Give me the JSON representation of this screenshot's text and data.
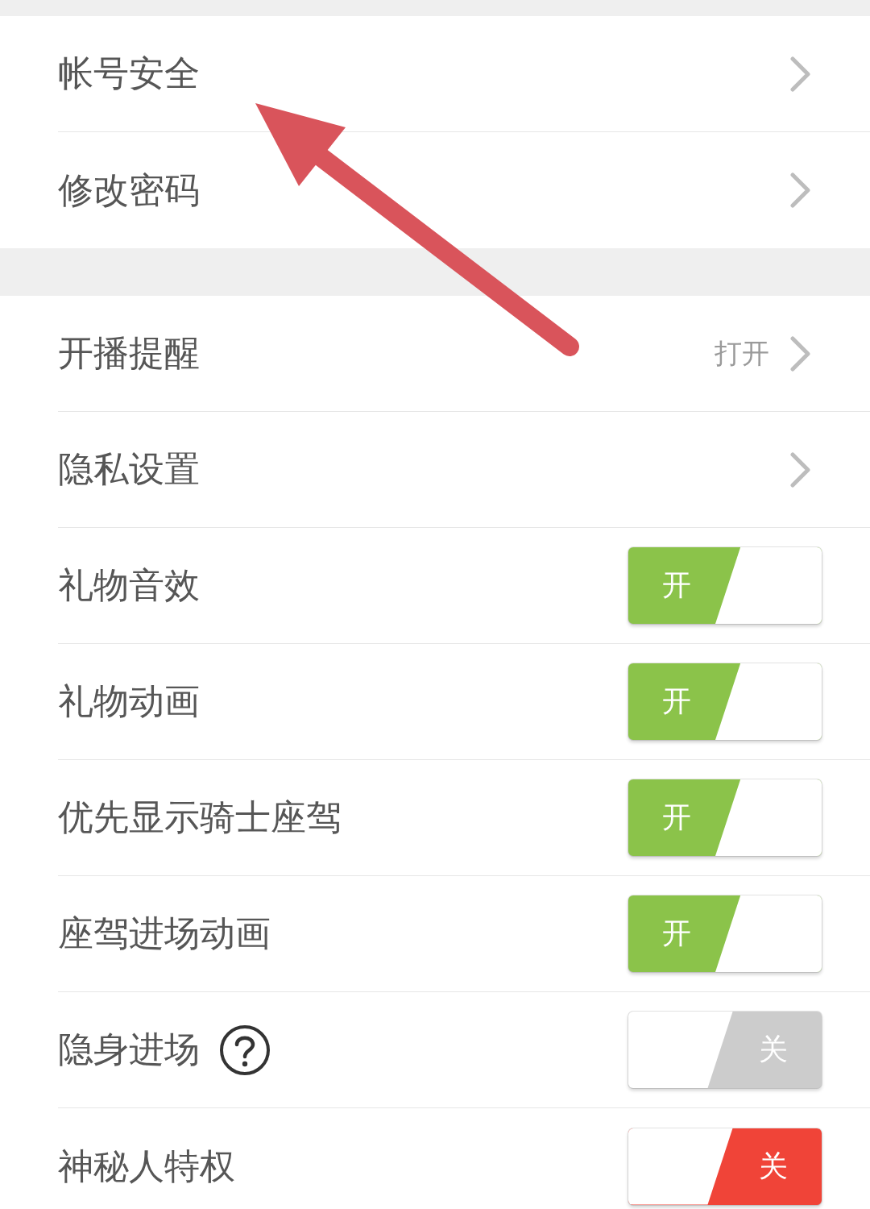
{
  "sections": [
    {
      "items": [
        {
          "kind": "link",
          "label": "帐号安全",
          "help": false
        },
        {
          "kind": "link",
          "label": "修改密码",
          "help": false
        }
      ]
    },
    {
      "items": [
        {
          "kind": "link",
          "label": "开播提醒",
          "value": "打开",
          "help": false
        },
        {
          "kind": "link",
          "label": "隐私设置",
          "help": false
        },
        {
          "kind": "toggle",
          "label": "礼物音效",
          "help": false,
          "on": true,
          "toggle_text": "开",
          "color": "#8bc34a"
        },
        {
          "kind": "toggle",
          "label": "礼物动画",
          "help": false,
          "on": true,
          "toggle_text": "开",
          "color": "#8bc34a"
        },
        {
          "kind": "toggle",
          "label": "优先显示骑士座驾",
          "help": false,
          "on": true,
          "toggle_text": "开",
          "color": "#8bc34a"
        },
        {
          "kind": "toggle",
          "label": "座驾进场动画",
          "help": false,
          "on": true,
          "toggle_text": "开",
          "color": "#8bc34a"
        },
        {
          "kind": "toggle",
          "label": "隐身进场",
          "help": true,
          "on": false,
          "toggle_text": "关",
          "color": "#cccccc"
        },
        {
          "kind": "toggle",
          "label": "神秘人特权",
          "help": false,
          "on": false,
          "toggle_text": "关",
          "color": "#f04438"
        }
      ]
    }
  ],
  "annotations": [
    {
      "kind": "arrow"
    }
  ]
}
